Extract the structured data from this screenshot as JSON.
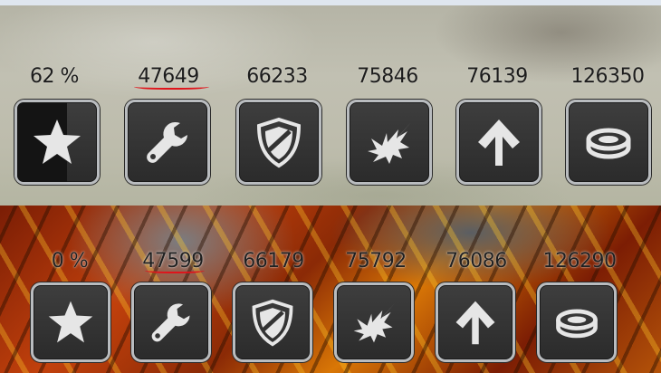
{
  "upgrades_top": {
    "progress_label": "62 %",
    "progress_fraction": 0.62,
    "items": [
      {
        "icon": "star-icon",
        "value": "62 %"
      },
      {
        "icon": "wrench-icon",
        "value": "47649"
      },
      {
        "icon": "shield-icon",
        "value": "66233"
      },
      {
        "icon": "explosion-icon",
        "value": "75846"
      },
      {
        "icon": "arrow-up-icon",
        "value": "76139"
      },
      {
        "icon": "ring-icon",
        "value": "126350"
      }
    ]
  },
  "upgrades_bottom": {
    "progress_label": "0 %",
    "progress_fraction": 0.0,
    "items": [
      {
        "icon": "star-icon",
        "value": "0 %"
      },
      {
        "icon": "wrench-icon",
        "value": "47599"
      },
      {
        "icon": "shield-icon",
        "value": "66179"
      },
      {
        "icon": "explosion-icon",
        "value": "75792"
      },
      {
        "icon": "arrow-up-icon",
        "value": "76086"
      },
      {
        "icon": "ring-icon",
        "value": "126290"
      }
    ]
  },
  "colors": {
    "annotation_underline": "#e0141b",
    "button_border": "#b9bcbf",
    "button_fill": "#333333",
    "icon_fill": "#e6e6e6"
  }
}
